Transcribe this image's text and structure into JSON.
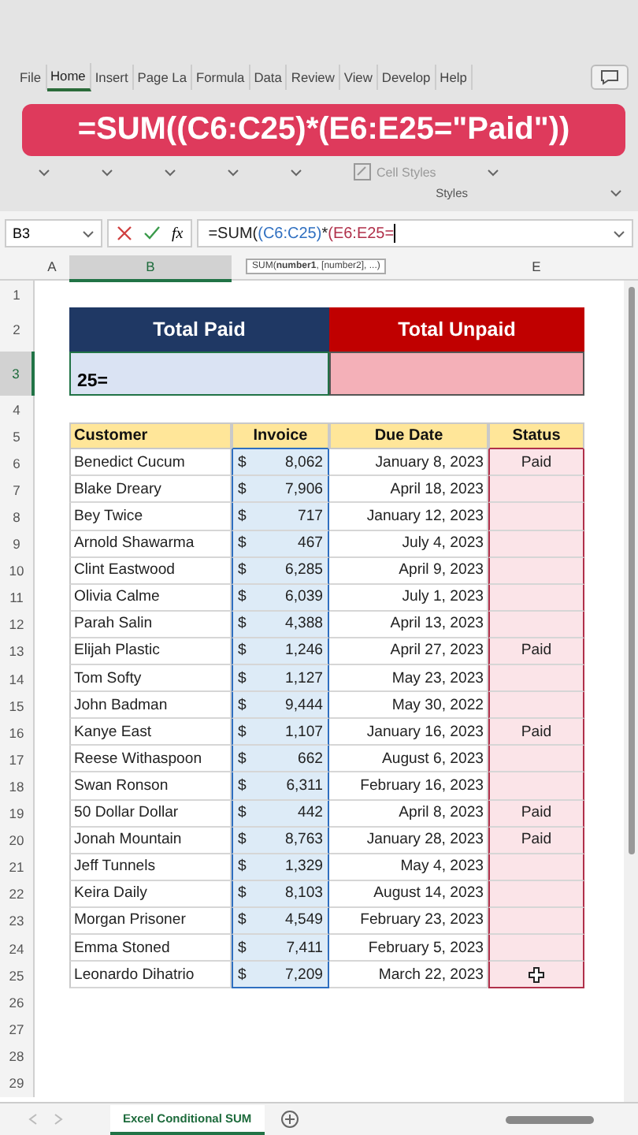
{
  "ribbon": {
    "tabs": [
      {
        "label": "File",
        "selected": false
      },
      {
        "label": "Home",
        "selected": true
      },
      {
        "label": "Insert",
        "selected": false
      },
      {
        "label": "Page La",
        "selected": false
      },
      {
        "label": "Formula",
        "selected": false
      },
      {
        "label": "Data",
        "selected": false
      },
      {
        "label": "Review",
        "selected": false
      },
      {
        "label": "View",
        "selected": false
      },
      {
        "label": "Develop",
        "selected": false
      },
      {
        "label": "Help",
        "selected": false
      }
    ],
    "cell_styles": "Cell Styles",
    "group_label": "Styles"
  },
  "formula_banner": "=SUM((C6:C25)*(E6:E25=\"Paid\"))",
  "formula_bar": {
    "name_box": "B3",
    "fx": "fx",
    "formula": [
      {
        "text": "=SUM(",
        "color": "#222222"
      },
      {
        "text": "(C6:C25)",
        "color": "#2f6fc0"
      },
      {
        "text": "*",
        "color": "#222222"
      },
      {
        "text": "(E6:E25=",
        "color": "#b0304a"
      }
    ]
  },
  "tooltip": "SUM(**number1**, [number2], ...)",
  "column_headers": [
    {
      "label": "A",
      "selected": false
    },
    {
      "label": "B",
      "selected": true
    },
    {
      "label": "E",
      "selected": false
    }
  ],
  "row_headers": [
    {
      "label": "1",
      "selected": false
    },
    {
      "label": "2",
      "selected": false
    },
    {
      "label": "3",
      "selected": true
    },
    {
      "label": "4",
      "selected": false
    },
    {
      "label": "5",
      "selected": false
    },
    {
      "label": "6",
      "selected": false
    },
    {
      "label": "7",
      "selected": false
    },
    {
      "label": "8",
      "selected": false
    },
    {
      "label": "9",
      "selected": false
    },
    {
      "label": "10",
      "selected": false
    },
    {
      "label": "11",
      "selected": false
    },
    {
      "label": "12",
      "selected": false
    },
    {
      "label": "13",
      "selected": false
    },
    {
      "label": "14",
      "selected": false
    },
    {
      "label": "15",
      "selected": false
    },
    {
      "label": "16",
      "selected": false
    },
    {
      "label": "17",
      "selected": false
    },
    {
      "label": "18",
      "selected": false
    },
    {
      "label": "19",
      "selected": false
    },
    {
      "label": "20",
      "selected": false
    },
    {
      "label": "21",
      "selected": false
    },
    {
      "label": "22",
      "selected": false
    },
    {
      "label": "23",
      "selected": false
    },
    {
      "label": "24",
      "selected": false
    },
    {
      "label": "25",
      "selected": false
    },
    {
      "label": "26",
      "selected": false
    },
    {
      "label": "27",
      "selected": false
    },
    {
      "label": "28",
      "selected": false
    },
    {
      "label": "29",
      "selected": false
    }
  ],
  "summary": {
    "paid_label": "Total Paid",
    "unpaid_label": "Total Unpaid",
    "paid_value": "25="
  },
  "table": {
    "columns": [
      "Customer",
      "Invoice",
      "Due Date",
      "Status"
    ],
    "rows": [
      {
        "customer": "Benedict Cucum",
        "currency": "$",
        "invoice": "8,062",
        "due_date": "January 8, 2023",
        "status": "Paid"
      },
      {
        "customer": "Blake Dreary",
        "currency": "$",
        "invoice": "7,906",
        "due_date": "April 18, 2023"
      },
      {
        "customer": "Bey Twice",
        "currency": "$",
        "invoice": "717",
        "due_date": "January 12, 2023"
      },
      {
        "customer": "Arnold Shawarma",
        "currency": "$",
        "invoice": "467",
        "due_date": "July 4, 2023"
      },
      {
        "customer": "Clint Eastwood",
        "currency": "$",
        "invoice": "6,285",
        "due_date": "April 9, 2023"
      },
      {
        "customer": "Olivia Calme",
        "currency": "$",
        "invoice": "6,039",
        "due_date": "July 1, 2023"
      },
      {
        "customer": "Parah Salin",
        "currency": "$",
        "invoice": "4,388",
        "due_date": "April 13, 2023"
      },
      {
        "customer": "Elijah Plastic",
        "currency": "$",
        "invoice": "1,246",
        "due_date": "April 27, 2023",
        "status": "Paid"
      },
      {
        "customer": "Tom Softy",
        "currency": "$",
        "invoice": "1,127",
        "due_date": "May 23, 2023"
      },
      {
        "customer": "John Badman",
        "currency": "$",
        "invoice": "9,444",
        "due_date": "May 30, 2022"
      },
      {
        "customer": "Kanye East",
        "currency": "$",
        "invoice": "1,107",
        "due_date": "January 16, 2023",
        "status": "Paid"
      },
      {
        "customer": "Reese Withaspoon",
        "currency": "$",
        "invoice": "662",
        "due_date": "August 6, 2023"
      },
      {
        "customer": "Swan Ronson",
        "currency": "$",
        "invoice": "6,311",
        "due_date": "February 16, 2023"
      },
      {
        "customer": "50 Dollar Dollar",
        "currency": "$",
        "invoice": "442",
        "due_date": "April 8, 2023",
        "status": "Paid"
      },
      {
        "customer": "Jonah Mountain",
        "currency": "$",
        "invoice": "8,763",
        "due_date": "January 28, 2023",
        "status": "Paid"
      },
      {
        "customer": "Jeff Tunnels",
        "currency": "$",
        "invoice": "1,329",
        "due_date": "May 4, 2023"
      },
      {
        "customer": "Keira Daily",
        "currency": "$",
        "invoice": "8,103",
        "due_date": "August 14, 2023"
      },
      {
        "customer": "Morgan Prisoner",
        "currency": "$",
        "invoice": "4,549",
        "due_date": "February 23, 2023"
      },
      {
        "customer": "Emma Stoned",
        "currency": "$",
        "invoice": "7,411",
        "due_date": "February 5, 2023"
      },
      {
        "customer": "Leonardo Dihatrio",
        "currency": "$",
        "invoice": "7,209",
        "due_date": "March 22, 2023"
      }
    ]
  },
  "sheet_tabs": [
    {
      "label": "Excel Conditional SUM",
      "selected": true
    }
  ]
}
